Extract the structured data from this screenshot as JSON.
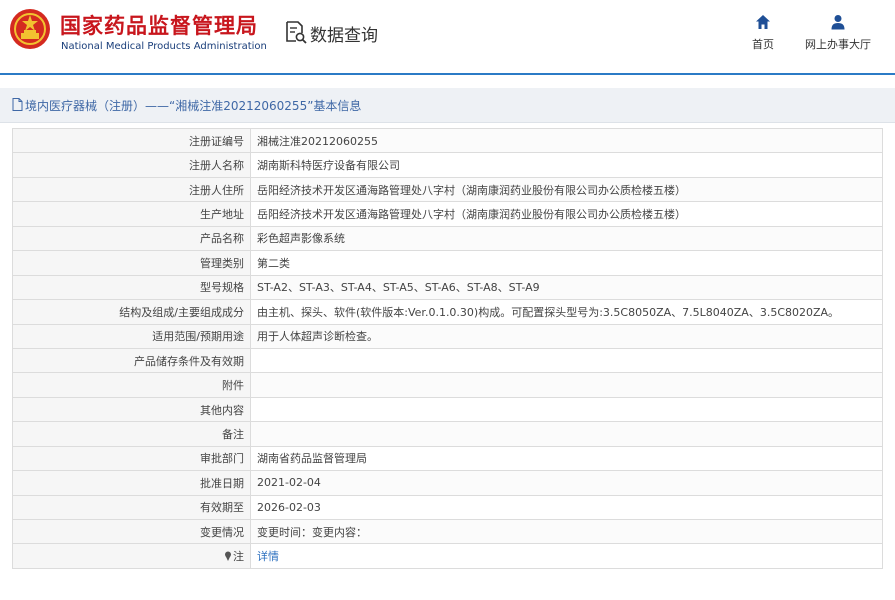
{
  "header": {
    "title_cn": "国家药品监督管理局",
    "title_en": "National Medical Products Administration",
    "section_title": "数据查询",
    "nav": {
      "home_label": "首页",
      "service_hall_label": "网上办事大厅"
    }
  },
  "breadcrumb": {
    "text": "境内医疗器械（注册）——“湘械注准20212060255”基本信息"
  },
  "record": {
    "rows": [
      {
        "label": "注册证编号",
        "value": "湘械注准20212060255"
      },
      {
        "label": "注册人名称",
        "value": "湖南斯科特医疗设备有限公司"
      },
      {
        "label": "注册人住所",
        "value": "岳阳经济技术开发区通海路管理处八字村（湖南康润药业股份有限公司办公质检楼五楼）"
      },
      {
        "label": "生产地址",
        "value": "岳阳经济技术开发区通海路管理处八字村（湖南康润药业股份有限公司办公质检楼五楼）"
      },
      {
        "label": "产品名称",
        "value": "彩色超声影像系统"
      },
      {
        "label": "管理类别",
        "value": "第二类"
      },
      {
        "label": "型号规格",
        "value": "ST-A2、ST-A3、ST-A4、ST-A5、ST-A6、ST-A8、ST-A9"
      },
      {
        "label": "结构及组成/主要组成成分",
        "value": "由主机、探头、软件(软件版本:Ver.0.1.0.30)构成。可配置探头型号为:3.5C8050ZA、7.5L8040ZA、3.5C8020ZA。"
      },
      {
        "label": "适用范围/预期用途",
        "value": "用于人体超声诊断检查。"
      },
      {
        "label": "产品储存条件及有效期",
        "value": ""
      },
      {
        "label": "附件",
        "value": ""
      },
      {
        "label": "其他内容",
        "value": ""
      },
      {
        "label": "备注",
        "value": ""
      },
      {
        "label": "审批部门",
        "value": "湖南省药品监督管理局"
      },
      {
        "label": "批准日期",
        "value": "2021-02-04"
      },
      {
        "label": "有效期至",
        "value": "2026-02-03"
      },
      {
        "label": "变更情况",
        "value": "变更时间：变更内容："
      }
    ],
    "note_row": {
      "label": "注",
      "link_text": "详情"
    }
  },
  "colors": {
    "brand_red": "#c8161d",
    "brand_blue": "#1a3e7a",
    "header_rule": "#2b7bc6",
    "link": "#2b6fbf"
  },
  "icons": {
    "search_section": "document-search-icon",
    "home": "home-icon",
    "service_hall": "user-icon",
    "breadcrumb": "document-icon",
    "note": "pin-icon"
  }
}
